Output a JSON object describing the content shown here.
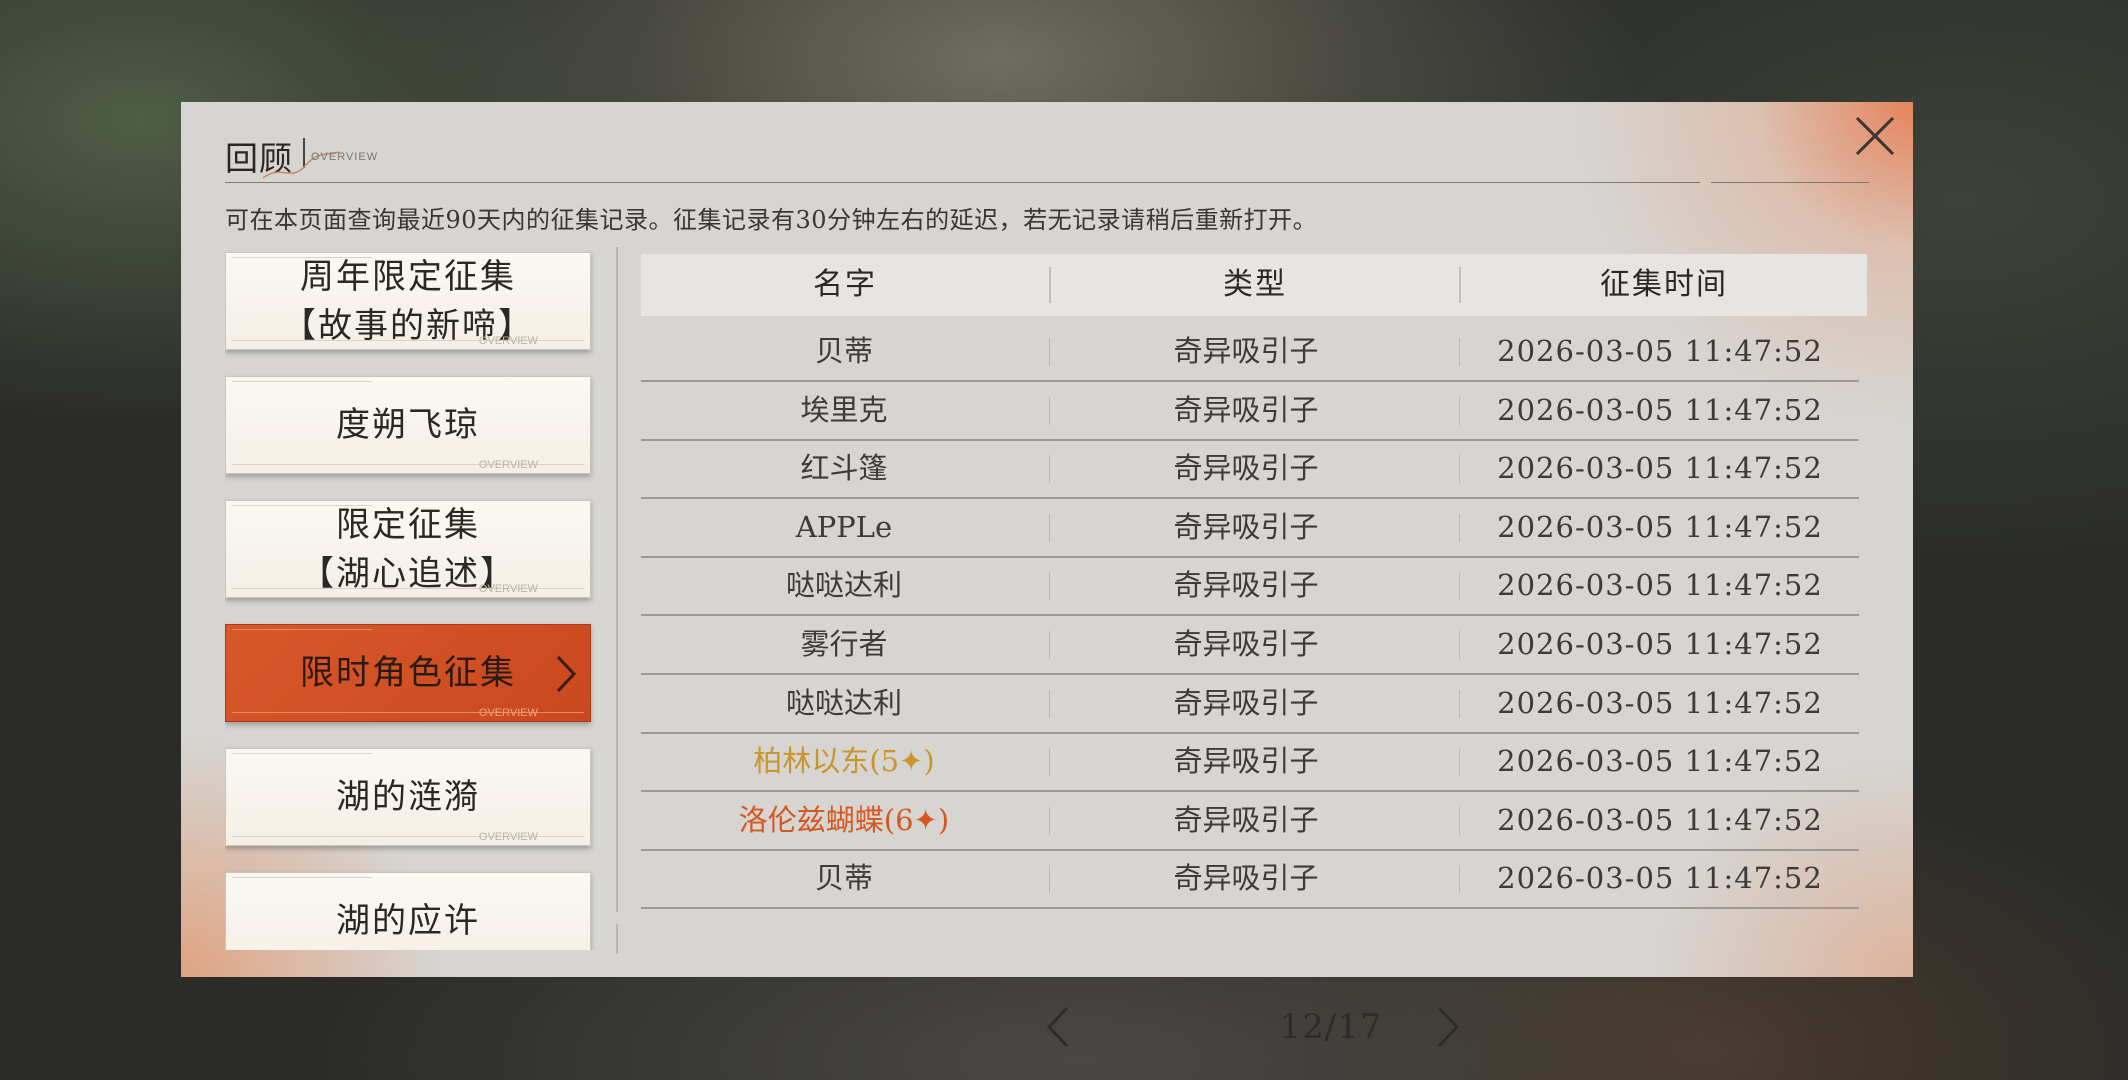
{
  "panel": {
    "title": "回顾",
    "title_sub": "OVERVIEW",
    "description": "可在本页面查询最近90天内的征集记录。征集记录有30分钟左右的延迟，若无记录请稍后重新打开。"
  },
  "tabs": [
    {
      "line1": "周年限定征集",
      "line2": "【故事的新啼】",
      "active": false
    },
    {
      "line1": "度朔飞琼",
      "line2": "",
      "active": false
    },
    {
      "line1": "限定征集",
      "line2": "【湖心追述】",
      "active": false
    },
    {
      "line1": "限时角色征集",
      "line2": "",
      "active": true
    },
    {
      "line1": "湖的涟漪",
      "line2": "",
      "active": false
    },
    {
      "line1": "湖的应许",
      "line2": "",
      "active": false
    }
  ],
  "tab_overview_label": "OVERVIEW",
  "table": {
    "headers": [
      "名字",
      "类型",
      "征集时间"
    ],
    "rows": [
      {
        "name": "贝蒂",
        "type": "奇异吸引子",
        "time": "2026-03-05 11:47:52",
        "rarity": "normal"
      },
      {
        "name": "埃里克",
        "type": "奇异吸引子",
        "time": "2026-03-05 11:47:52",
        "rarity": "normal"
      },
      {
        "name": "红斗篷",
        "type": "奇异吸引子",
        "time": "2026-03-05 11:47:52",
        "rarity": "normal"
      },
      {
        "name": "APPLe",
        "type": "奇异吸引子",
        "time": "2026-03-05 11:47:52",
        "rarity": "normal"
      },
      {
        "name": "哒哒达利",
        "type": "奇异吸引子",
        "time": "2026-03-05 11:47:52",
        "rarity": "normal"
      },
      {
        "name": "雾行者",
        "type": "奇异吸引子",
        "time": "2026-03-05 11:47:52",
        "rarity": "normal"
      },
      {
        "name": "哒哒达利",
        "type": "奇异吸引子",
        "time": "2026-03-05 11:47:52",
        "rarity": "normal"
      },
      {
        "name": "柏林以东(5✦)",
        "type": "奇异吸引子",
        "time": "2026-03-05 11:47:52",
        "rarity": "five"
      },
      {
        "name": "洛伦兹蝴蝶(6✦)",
        "type": "奇异吸引子",
        "time": "2026-03-05 11:47:52",
        "rarity": "six"
      },
      {
        "name": "贝蒂",
        "type": "奇异吸引子",
        "time": "2026-03-05 11:47:52",
        "rarity": "normal"
      }
    ]
  },
  "pager": {
    "text": "12/17",
    "current": 12,
    "total": 17
  },
  "colors": {
    "accent": "#d4552a",
    "five_star": "#c9962c",
    "six_star": "#d4581f",
    "panel_bg": "#d6d5d2"
  },
  "icons": {
    "close": "close-icon",
    "prev": "chevron-left-icon",
    "next": "chevron-right-icon",
    "tab_arrow": "chevron-right-icon"
  }
}
